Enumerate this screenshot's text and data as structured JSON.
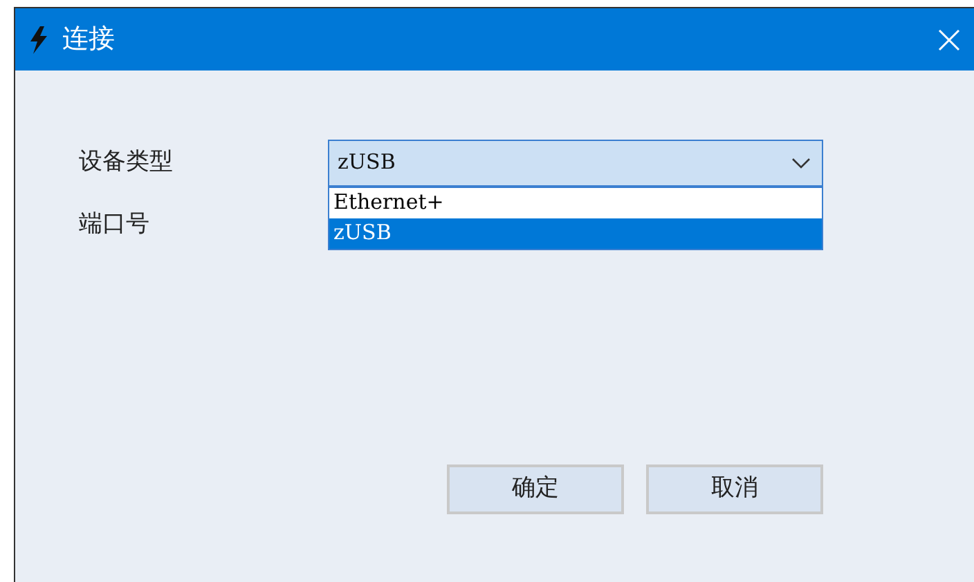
{
  "window": {
    "title": "连接"
  },
  "fields": [
    {
      "label": "设备类型",
      "kind": "combo",
      "value": "zUSB",
      "expanded": true,
      "options": [
        {
          "label": "Ethernet+",
          "selected": false
        },
        {
          "label": "zUSB",
          "selected": true
        }
      ]
    },
    {
      "label": "端口号",
      "kind": "text"
    }
  ],
  "buttons": [
    "确定",
    "取消"
  ]
}
